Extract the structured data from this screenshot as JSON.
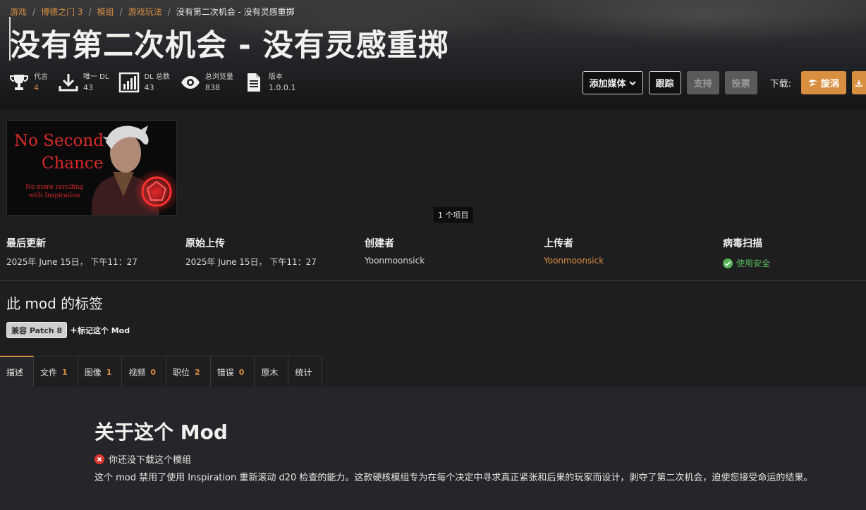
{
  "breadcrumb": [
    "游戏",
    "博德之门 3",
    "模组",
    "游戏玩法",
    "没有第二次机会 - 没有灵感重掷"
  ],
  "title": "没有第二次机会 - 没有灵感重掷",
  "stats": [
    {
      "label": "代言",
      "value": "4",
      "icon": "trophy-icon"
    },
    {
      "label": "唯一 DL",
      "value": "43",
      "icon": "download-icon"
    },
    {
      "label": "DL 总数",
      "value": "43",
      "icon": "bar-chart-icon"
    },
    {
      "label": "总浏览量",
      "value": "838",
      "icon": "eye-icon"
    },
    {
      "label": "版本",
      "value": "1.0.0.1",
      "icon": "document-icon"
    }
  ],
  "actions": {
    "add_media": "添加媒体",
    "track": "跟踪",
    "support": "支持",
    "vote": "投票",
    "download_label": "下载:",
    "vortex": "旋涡"
  },
  "gallery": {
    "image_text_main": [
      "No Second",
      "Chance"
    ],
    "image_text_sub": [
      "No more rerolling",
      "with Inspiration"
    ],
    "item_count": "1 个项目"
  },
  "meta": [
    {
      "heading": "最后更新",
      "value": "2025年 June 15日， 下午11：27"
    },
    {
      "heading": "原始上传",
      "value": "2025年 June 15日， 下午11：27"
    },
    {
      "heading": "创建者",
      "value": "Yoonmoonsick"
    },
    {
      "heading": "上传者",
      "value": "Yoonmoonsick"
    },
    {
      "heading": "病毒扫描",
      "value": "使用安全"
    }
  ],
  "tags": {
    "title": "此 mod 的标签",
    "items": [
      "兼容 Patch 8"
    ],
    "add": "标记这个 Mod"
  },
  "tabs": [
    {
      "label": "描述",
      "count": ""
    },
    {
      "label": "文件",
      "count": "1"
    },
    {
      "label": "图像",
      "count": "1"
    },
    {
      "label": "视频",
      "count": "0"
    },
    {
      "label": "职位",
      "count": "2"
    },
    {
      "label": "错误",
      "count": "0"
    },
    {
      "label": "原木",
      "count": ""
    },
    {
      "label": "统计",
      "count": ""
    }
  ],
  "about": {
    "title": "关于这个 Mod",
    "not_downloaded": "你还没下载这个模组",
    "description": "这个 mod 禁用了使用 Inspiration 重新滚动 d20 检查的能力。这款硬核模组专为在每个决定中寻求真正紧张和后果的玩家而设计，剥夺了第二次机会，迫使您接受命运的结果。"
  },
  "colors": {
    "accent": "#d98f40",
    "safe": "#57b557",
    "error": "#d9342b"
  }
}
